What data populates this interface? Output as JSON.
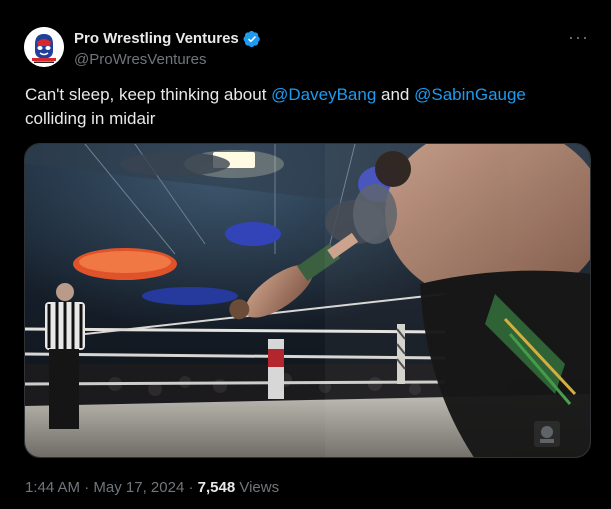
{
  "author": {
    "display_name": "Pro Wrestling Ventures",
    "handle": "@ProWresVentures",
    "verified_color": "#1d9bf0",
    "avatar_icon": "pwv-logo-icon"
  },
  "tweet": {
    "text_1": "Can't sleep, keep thinking about ",
    "mention_1": "@DaveyBang",
    "text_2": " and ",
    "mention_2": "@SabinGauge",
    "text_3": " colliding in midair"
  },
  "media": {
    "type": "video-frame",
    "watermark_icon": "watermark-logo-icon"
  },
  "meta": {
    "time": "1:44 AM",
    "separator": " · ",
    "date": "May 17, 2024",
    "views_count": "7,548",
    "views_label": " Views"
  },
  "colors": {
    "background": "#000000",
    "text": "#e7e9ea",
    "secondary": "#71767b",
    "link": "#1d9bf0"
  }
}
